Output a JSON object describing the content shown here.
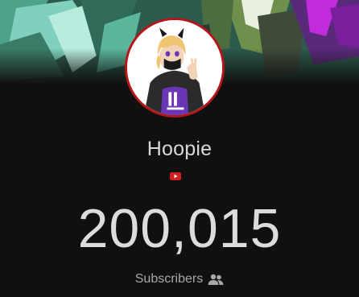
{
  "channel": {
    "name": "Hoopie",
    "avatar_icon": "character-avatar",
    "platform_icon": "youtube-icon"
  },
  "stats": {
    "subscriber_count": "200,015",
    "subscriber_label": "Subscribers",
    "label_icon": "people-icon"
  },
  "colors": {
    "background": "#101010",
    "avatar_ring": "#b4161b",
    "youtube_red": "#d21f1f",
    "text_primary": "#dcdcdc",
    "text_secondary": "#a8a8a8"
  }
}
